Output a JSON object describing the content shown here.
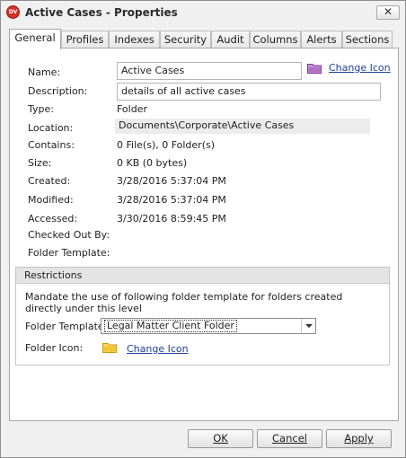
{
  "window": {
    "title": "Active Cases - Properties",
    "close_glyph": "✕",
    "app_icon_text": "DV"
  },
  "tabs": [
    {
      "label": "General",
      "active": true
    },
    {
      "label": "Profiles"
    },
    {
      "label": "Indexes"
    },
    {
      "label": "Security"
    },
    {
      "label": "Audit"
    },
    {
      "label": "Columns"
    },
    {
      "label": "Alerts"
    },
    {
      "label": "Sections"
    }
  ],
  "general": {
    "name_label": "Name:",
    "name_value": "Active Cases",
    "change_icon_label": "Change Icon",
    "description_label": "Description:",
    "description_value": "details of all active cases",
    "type_label": "Type:",
    "type_value": "Folder",
    "location_label": "Location:",
    "location_value": "Documents\\Corporate\\Active Cases",
    "contains_label": "Contains:",
    "contains_value": "0 File(s), 0 Folder(s)",
    "size_label": "Size:",
    "size_value": "0 KB (0 bytes)",
    "created_label": "Created:",
    "created_value": "3/28/2016 5:37:04 PM",
    "modified_label": "Modified:",
    "modified_value": "3/28/2016 5:37:04 PM",
    "accessed_label": "Accessed:",
    "accessed_value": "3/30/2016 8:59:45 PM",
    "checked_out_label": "Checked Out By:",
    "folder_template_label": "Folder Template:"
  },
  "restrictions": {
    "title": "Restrictions",
    "description": "Mandate the use of following folder template for folders created directly under this level",
    "folder_template_label": "Folder Template:",
    "folder_template_value": "Legal Matter Client Folder",
    "folder_icon_label": "Folder Icon:",
    "change_icon_label": "Change Icon"
  },
  "buttons": {
    "ok": "OK",
    "cancel": "Cancel",
    "apply": "Apply"
  },
  "colors": {
    "link": "#1b3f9a",
    "folder_purple": "#9b3fae",
    "folder_yellow": "#f2c531"
  },
  "icons": {
    "window": "app-logo-icon",
    "close": "close-icon",
    "name_folder": "folder-icon",
    "restriction_folder": "folder-icon",
    "dropdown": "chevron-down-icon"
  }
}
